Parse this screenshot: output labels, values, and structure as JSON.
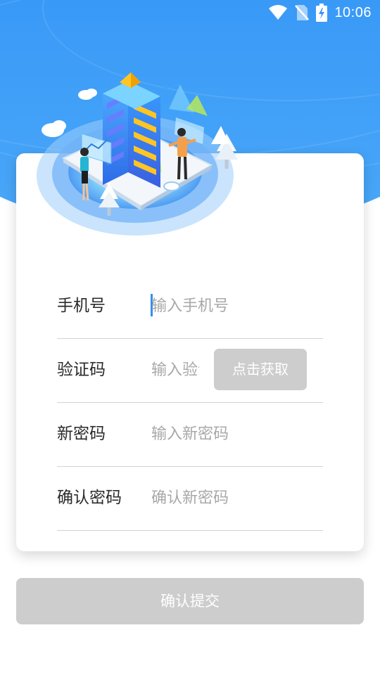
{
  "status_bar": {
    "time": "10:06",
    "icons": [
      "wifi-icon",
      "no-sim-icon",
      "battery-charging-icon"
    ]
  },
  "form": {
    "phone": {
      "label": "手机号",
      "placeholder": "输入手机号",
      "value": ""
    },
    "code": {
      "label": "验证码",
      "placeholder": "输入验证码",
      "value": "",
      "button_label": "点击获取"
    },
    "new_password": {
      "label": "新密码",
      "placeholder": "输入新密码",
      "value": ""
    },
    "confirm_password": {
      "label": "确认密码",
      "placeholder": "确认新密码",
      "value": ""
    }
  },
  "submit_label": "确认提交",
  "colors": {
    "header_blue": "#2e8df6",
    "cursor_blue": "#2f8ff3",
    "disabled_button": "#cdcdcd",
    "divider": "#d2d2d2"
  }
}
